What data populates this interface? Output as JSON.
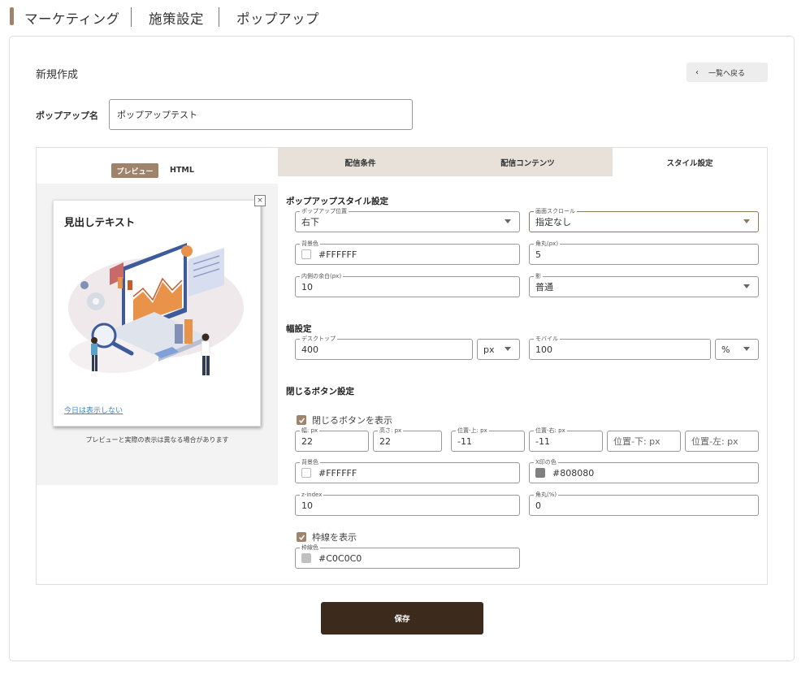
{
  "breadcrumb": [
    "マーケティング",
    "施策設定",
    "ポップアップ"
  ],
  "page": {
    "title": "新規作成",
    "back_label": "一覧へ戻る",
    "name_label": "ポップアップ名",
    "name_value": "ポップアップテスト",
    "save_label": "保存"
  },
  "preview": {
    "tab_preview": "プレビュー",
    "tab_html": "HTML",
    "heading": "見出しテキスト",
    "close_glyph": "×",
    "link": "今日は表示しない",
    "note": "プレビューと実際の表示は異なる場合があります"
  },
  "tabs": [
    "配信条件",
    "配信コンテンツ",
    "スタイル設定"
  ],
  "style": {
    "section1": "ポップアップスタイル設定",
    "position": {
      "label": "ポップアップ位置",
      "value": "右下"
    },
    "scroll": {
      "label": "画面スクロール",
      "value": "指定なし"
    },
    "bg": {
      "label": "背景色",
      "value": "#FFFFFF",
      "color": "#FFFFFF"
    },
    "radius": {
      "label": "角丸(px)",
      "value": "5"
    },
    "padding": {
      "label": "内側の余白(px)",
      "value": "10"
    },
    "shadow": {
      "label": "影",
      "value": "普通"
    },
    "section2": "幅設定",
    "desktop": {
      "label": "デスクトップ",
      "value": "400",
      "unit": "px"
    },
    "mobile": {
      "label": "モバイル",
      "value": "100",
      "unit": "%"
    },
    "section3": "閉じるボタン設定",
    "show_close": {
      "label": "閉じるボタンを表示",
      "checked": true
    },
    "close_w": {
      "label": "幅: px",
      "value": "22"
    },
    "close_h": {
      "label": "高さ: px",
      "value": "22"
    },
    "close_top": {
      "label": "位置-上: px",
      "value": "-11"
    },
    "close_right": {
      "label": "位置-右: px",
      "value": "-11"
    },
    "close_bottom": {
      "placeholder": "位置-下: px"
    },
    "close_left": {
      "placeholder": "位置-左: px"
    },
    "close_bg": {
      "label": "背景色",
      "value": "#FFFFFF",
      "color": "#FFFFFF"
    },
    "x_color": {
      "label": "X印の色",
      "value": "#808080",
      "color": "#808080"
    },
    "zindex": {
      "label": "z-index",
      "value": "10"
    },
    "close_radius": {
      "label": "角丸(%)",
      "value": "0"
    },
    "show_border": {
      "label": "枠線を表示",
      "checked": true
    },
    "border_color": {
      "label": "枠線色",
      "value": "#C0C0C0",
      "color": "#C0C0C0"
    }
  },
  "colors": {
    "accent": "#a0836b",
    "save": "#3c2a1c",
    "tab_bg": "#e7e1da"
  }
}
